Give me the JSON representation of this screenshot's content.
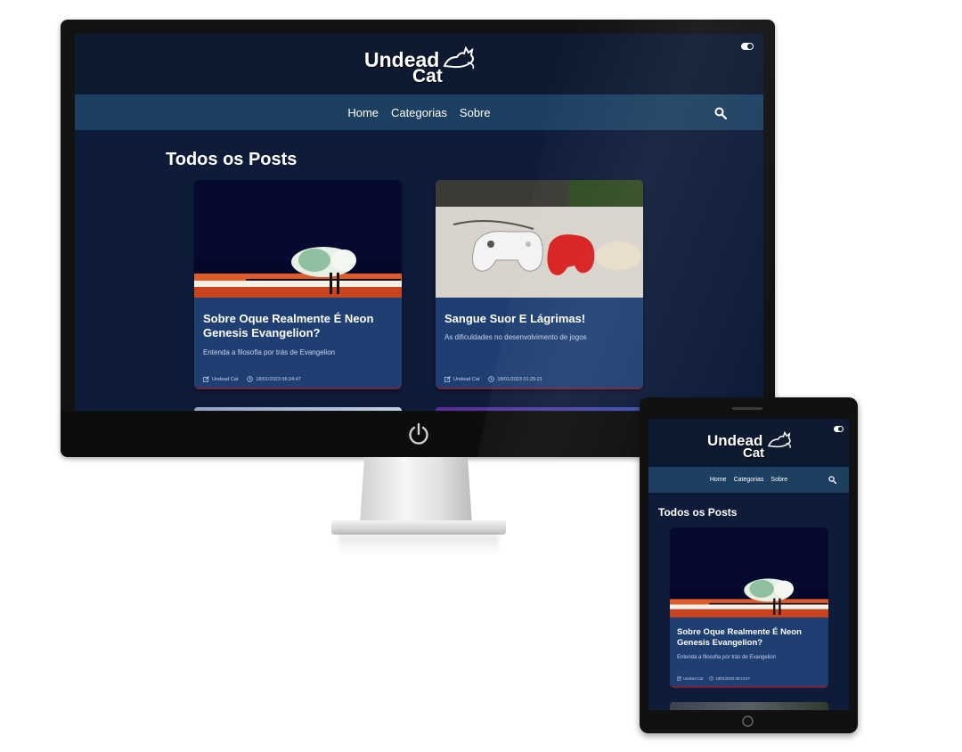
{
  "site": {
    "logo_line1": "Undead",
    "logo_line2": "Cat",
    "nav": [
      "Home",
      "Categorias",
      "Sobre"
    ],
    "heading": "Todos os Posts"
  },
  "posts": [
    {
      "title": "Sobre Oque Realmente É Neon Genesis Evangelion?",
      "subtitle": "Entenda a filosofia por trás de Evangelion",
      "author": "Undead Cat",
      "date": "18/01/2023 06:24:47"
    },
    {
      "title": "Sangue Suor E Lágrimas!",
      "subtitle": "As dificuldades no desenvolvimento de jogos",
      "author": "Undead Cat",
      "date": "18/01/2023 01:25:21"
    }
  ],
  "icons": {
    "power": "power-icon",
    "search": "search-icon",
    "toggle": "theme-toggle-icon",
    "author": "edit-icon",
    "date": "clock-icon",
    "home_button": "home-button-icon"
  },
  "colors": {
    "page_bg": "#0e1c3a",
    "header_bg": "#0d1a30",
    "nav_bg": "#1d3f62",
    "card_bg": "#1f3f73",
    "card_accent": "#7a1f3d"
  }
}
